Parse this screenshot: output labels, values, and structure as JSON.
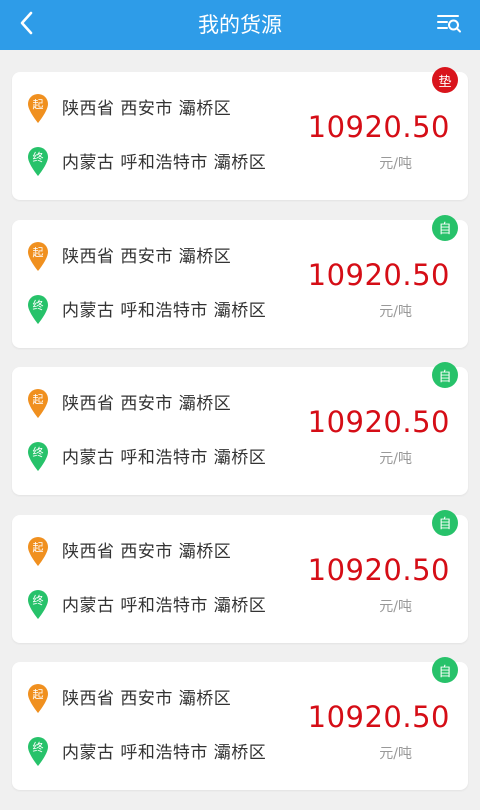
{
  "header": {
    "title": "我的货源",
    "back_icon": "chevron-left-icon",
    "filter_icon": "filter-search-icon"
  },
  "colors": {
    "header_bg": "#2e9ce8",
    "price": "#d50d16",
    "start_pin": "#f0901f",
    "end_pin": "#27c26a",
    "badge_red": "#d9141c",
    "badge_green": "#27c26a"
  },
  "pins": {
    "start_label": "起",
    "end_label": "终"
  },
  "cards": [
    {
      "from": "陕西省 西安市 灞桥区",
      "to": "内蒙古 呼和浩特市 灞桥区",
      "price": "10920.50",
      "unit": "元/吨",
      "badge": "垫",
      "badge_color": "red"
    },
    {
      "from": "陕西省 西安市 灞桥区",
      "to": "内蒙古 呼和浩特市 灞桥区",
      "price": "10920.50",
      "unit": "元/吨",
      "badge": "自",
      "badge_color": "green"
    },
    {
      "from": "陕西省 西安市 灞桥区",
      "to": "内蒙古 呼和浩特市 灞桥区",
      "price": "10920.50",
      "unit": "元/吨",
      "badge": "自",
      "badge_color": "green"
    },
    {
      "from": "陕西省 西安市 灞桥区",
      "to": "内蒙古 呼和浩特市 灞桥区",
      "price": "10920.50",
      "unit": "元/吨",
      "badge": "自",
      "badge_color": "green"
    },
    {
      "from": "陕西省 西安市 灞桥区",
      "to": "内蒙古 呼和浩特市 灞桥区",
      "price": "10920.50",
      "unit": "元/吨",
      "badge": "自",
      "badge_color": "green"
    }
  ]
}
